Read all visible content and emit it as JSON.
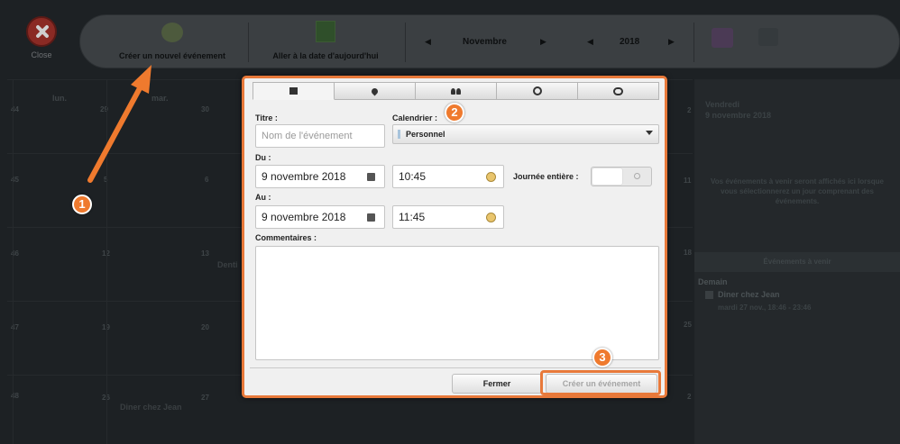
{
  "toolbar": {
    "close_label": "Close",
    "new_event_label": "Créer un nouvel événement",
    "today_label": "Aller à la date d'aujourd'hui",
    "month": "Novembre",
    "year": "2018",
    "prev_symbol": "◀",
    "next_symbol": "▶",
    "export_label": "",
    "import_label": ""
  },
  "calendar": {
    "day_headers": [
      "lun.",
      "mar."
    ],
    "weeks": [
      {
        "week": "44",
        "days": [
          "29",
          "30"
        ],
        "side": "2"
      },
      {
        "week": "45",
        "days": [
          "5",
          "6"
        ],
        "side": "11"
      },
      {
        "week": "46",
        "days": [
          "12",
          "13"
        ],
        "side": "18"
      },
      {
        "week": "47",
        "days": [
          "19",
          "20"
        ],
        "side": "25"
      },
      {
        "week": "48",
        "days": [
          "26",
          "27"
        ],
        "side": "2"
      }
    ],
    "event_dentist": "Denti",
    "event_dinner": "Diner chez Jean"
  },
  "right_panel": {
    "date_day": "Vendredi",
    "date_full": "9 novembre 2018",
    "info": "Vos événements à venir seront affichés ici lorsque vous sélectionnerez un jour comprenant des événements.",
    "upcoming_header": "Événements à venir",
    "tomorrow": "Demain",
    "event_title": "Diner chez Jean",
    "event_time": "mardi 27 nov., 18:46 - 23:46"
  },
  "dialog": {
    "tabs": [
      {
        "name": "tab-details",
        "icon": "square-icon"
      },
      {
        "name": "tab-location",
        "icon": "location-pin-icon"
      },
      {
        "name": "tab-attendees",
        "icon": "people-icon"
      },
      {
        "name": "tab-alarms",
        "icon": "alarm-clock-icon"
      },
      {
        "name": "tab-repeat",
        "icon": "repeat-icon"
      }
    ],
    "title_label": "Titre :",
    "title_placeholder": "Nom de l'événement",
    "calendar_label": "Calendrier :",
    "calendar_value": "Personnel",
    "from_label": "Du :",
    "from_date": "9 novembre 2018",
    "from_time": "10:45",
    "all_day_label": "Journée entière :",
    "to_label": "Au :",
    "to_date": "9 novembre 2018",
    "to_time": "11:45",
    "comments_label": "Commentaires :",
    "close_button": "Fermer",
    "create_button": "Créer un événement"
  },
  "annotations": {
    "step1": "1",
    "step2": "2",
    "step3": "3",
    "color": "#e8793a"
  }
}
